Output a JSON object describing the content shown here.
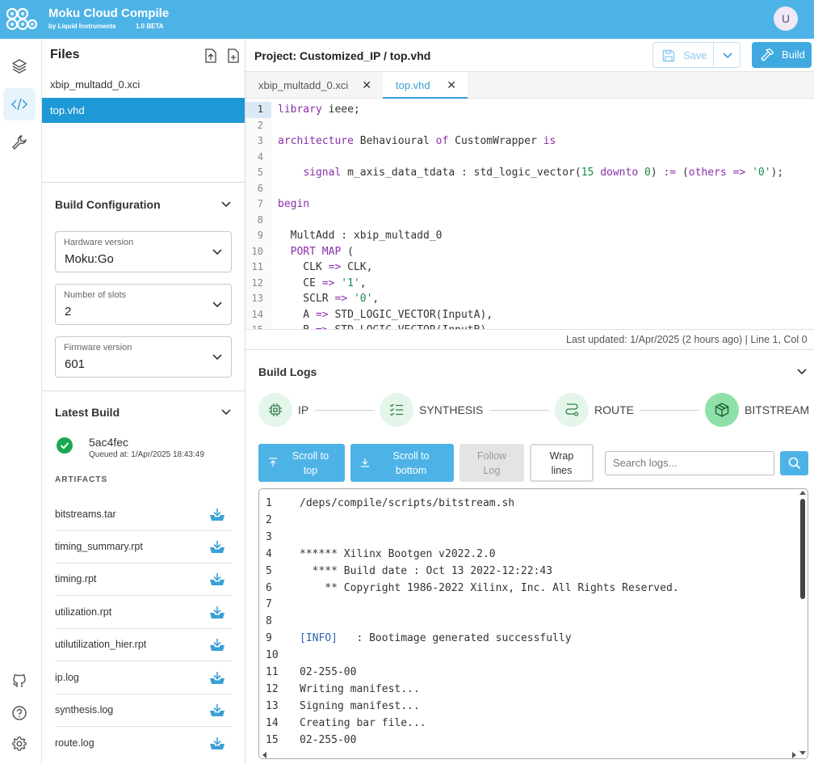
{
  "app": {
    "title": "Moku Cloud Compile",
    "subtitle": "by Liquid Instruments",
    "version": "1.0 BETA",
    "avatar_initial": "U",
    "brand_color": "#4db3e6"
  },
  "rail": {
    "items": [
      {
        "icon": "layers-icon"
      },
      {
        "icon": "code-icon",
        "active": true
      },
      {
        "icon": "wrench-icon"
      }
    ],
    "bottom": [
      {
        "icon": "github-icon"
      },
      {
        "icon": "help-icon"
      },
      {
        "icon": "settings-gear-icon"
      }
    ]
  },
  "files": {
    "title": "Files",
    "items": [
      {
        "name": "xbip_multadd_0.xci"
      },
      {
        "name": "top.vhd",
        "selected": true
      }
    ]
  },
  "build_config": {
    "title": "Build Configuration",
    "hardware": {
      "label": "Hardware version",
      "value": "Moku:Go"
    },
    "slots": {
      "label": "Number of slots",
      "value": "2"
    },
    "firmware": {
      "label": "Firmware version",
      "value": "601"
    }
  },
  "latest_build": {
    "title": "Latest Build",
    "hash": "5ac4fec",
    "queued": "Queued at: 1/Apr/2025 18:43:49",
    "artifacts_label": "ARTIFACTS",
    "artifacts": [
      "bitstreams.tar",
      "timing_summary.rpt",
      "timing.rpt",
      "utilization.rpt",
      "utilutilization_hier.rpt",
      "ip.log",
      "synthesis.log",
      "route.log"
    ]
  },
  "editor": {
    "project_title": "Project:  Customized_IP / top.vhd",
    "save_label": "Save",
    "build_label": "Build",
    "tabs": [
      {
        "label": "xbip_multadd_0.xci"
      },
      {
        "label": "top.vhd",
        "active": true
      }
    ],
    "status": "Last updated: 1/Apr/2025 (2 hours ago) | Line 1, Col 0"
  },
  "code_lines": [
    "library ieee;",
    "",
    "architecture Behavioural of CustomWrapper is",
    "",
    "    signal m_axis_data_tdata : std_logic_vector(15 downto 0) := (others => '0');",
    "",
    "begin",
    "",
    "  MultAdd : xbip_multadd_0",
    "  PORT MAP (",
    "    CLK => CLK,",
    "    CE => '1',",
    "    SCLR => '0',",
    "    A => STD_LOGIC_VECTOR(InputA),",
    "    B => STD_LOGIC_VECTOR(InputB),"
  ],
  "build_logs": {
    "title": "Build Logs",
    "stages": [
      {
        "label": "IP",
        "icon": "chip-icon"
      },
      {
        "label": "SYNTHESIS",
        "icon": "checklist-icon"
      },
      {
        "label": "ROUTE",
        "icon": "route-icon"
      },
      {
        "label": "BITSTREAM",
        "icon": "cube-icon",
        "done": true
      }
    ],
    "buttons": {
      "scroll_top": "Scroll to top",
      "scroll_bottom": "Scroll to bottom",
      "follow": "Follow Log",
      "wrap": "Wrap lines"
    },
    "search_placeholder": "Search logs...",
    "lines": [
      "/deps/compile/scripts/bitstream.sh",
      "",
      "",
      "****** Xilinx Bootgen v2022.2.0",
      "  **** Build date : Oct 13 2022-12:22:43",
      "    ** Copyright 1986-2022 Xilinx, Inc. All Rights Reserved.",
      "",
      "",
      "[INFO]   : Bootimage generated successfully",
      "",
      "02-255-00",
      "Writing manifest...",
      "Signing manifest...",
      "Creating bar file...",
      "02-255-00"
    ]
  }
}
